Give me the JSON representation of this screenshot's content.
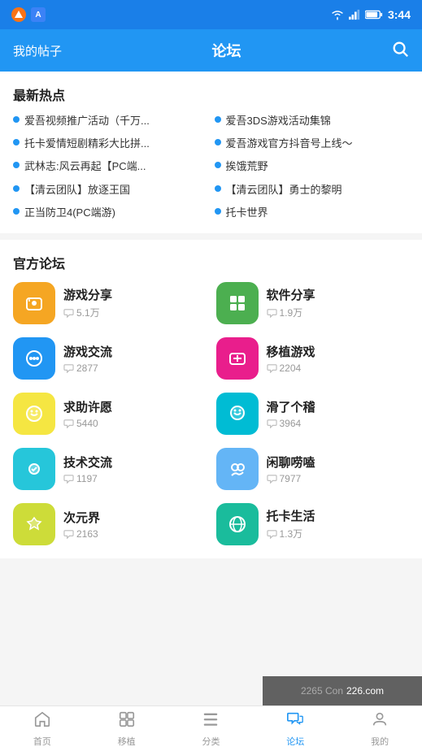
{
  "statusBar": {
    "time": "3:44"
  },
  "header": {
    "leftLabel": "我的帖子",
    "title": "论坛",
    "searchLabel": "搜索"
  },
  "hotSection": {
    "title": "最新热点",
    "items": [
      {
        "id": 1,
        "text": "爱吾视频推广活动（千万..."
      },
      {
        "id": 2,
        "text": "爱吾3DS游戏活动集锦"
      },
      {
        "id": 3,
        "text": "托卡爱情短剧精彩大比拼..."
      },
      {
        "id": 4,
        "text": "爱吾游戏官方抖音号上线～"
      },
      {
        "id": 5,
        "text": "武林志:风云再起【PC端..."
      },
      {
        "id": 6,
        "text": "挨饿荒野"
      },
      {
        "id": 7,
        "text": "【清云团队】放逐王国"
      },
      {
        "id": 8,
        "text": "【清云团队】勇士的黎明"
      },
      {
        "id": 9,
        "text": "正当防卫4(PC端游)"
      },
      {
        "id": 10,
        "text": "托卡世界"
      }
    ]
  },
  "forumSection": {
    "title": "官方论坛",
    "items": [
      {
        "id": 1,
        "name": "游戏分享",
        "count": "5.1万",
        "bg": "bg-orange",
        "icon": "🕹️"
      },
      {
        "id": 2,
        "name": "软件分享",
        "count": "1.9万",
        "bg": "bg-green",
        "icon": "⊞"
      },
      {
        "id": 3,
        "name": "游戏交流",
        "count": "2877",
        "bg": "bg-blue",
        "icon": "🎮"
      },
      {
        "id": 4,
        "name": "移植游戏",
        "count": "2204",
        "bg": "bg-pink",
        "icon": "🎮"
      },
      {
        "id": 5,
        "name": "求助许愿",
        "count": "5440",
        "bg": "bg-yellow",
        "icon": "😊"
      },
      {
        "id": 6,
        "name": "滑了个稽",
        "count": "3964",
        "bg": "bg-teal",
        "icon": "👻"
      },
      {
        "id": 7,
        "name": "技术交流",
        "count": "1197",
        "bg": "bg-cyan",
        "icon": "👾"
      },
      {
        "id": 8,
        "name": "闲聊唠嗑",
        "count": "7977",
        "bg": "bg-lightblue",
        "icon": "👥"
      },
      {
        "id": 9,
        "name": "次元界",
        "count": "2163",
        "bg": "bg-lime",
        "icon": "🦊"
      },
      {
        "id": 10,
        "name": "托卡生活",
        "count": "1.3万",
        "bg": "bg-turquoise",
        "icon": "🌍"
      }
    ]
  },
  "bottomNav": {
    "items": [
      {
        "id": "home",
        "label": "首页",
        "active": false
      },
      {
        "id": "migrate",
        "label": "移植",
        "active": false
      },
      {
        "id": "category",
        "label": "分类",
        "active": false
      },
      {
        "id": "forum",
        "label": "论坛",
        "active": true
      },
      {
        "id": "me",
        "label": "我的",
        "active": false
      }
    ]
  },
  "watermark": {
    "text": "226.com"
  },
  "commentIcon": "💬"
}
